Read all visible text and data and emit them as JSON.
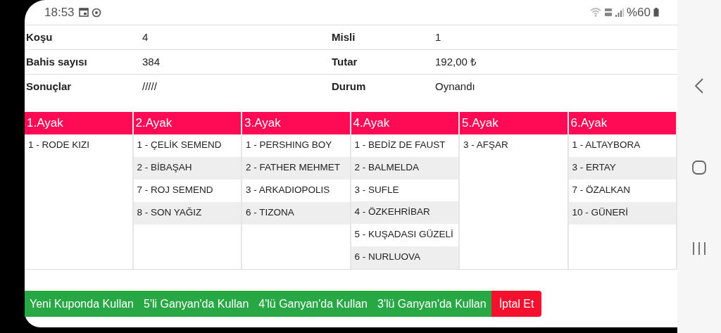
{
  "status_bar": {
    "time": "18:53",
    "battery": "%60"
  },
  "summary": [
    {
      "label": "Koşu",
      "value": "4",
      "label_2": "Misli",
      "value_2": "1"
    },
    {
      "label": "Bahis sayısı",
      "value": "384",
      "label_2": "Tutar",
      "value_2": "192,00 ₺"
    },
    {
      "label": "Sonuçlar",
      "value": "/////",
      "label_2": "Durum",
      "value_2": "Oynandı"
    }
  ],
  "legs": [
    {
      "title": "1.Ayak",
      "horses": [
        "1 - RODE KIZI"
      ]
    },
    {
      "title": "2.Ayak",
      "horses": [
        "1 - ÇELİK SEMEND",
        "2 - BİBAŞAH",
        "7 - ROJ SEMEND",
        "8 - SON YAĞIZ"
      ]
    },
    {
      "title": "3.Ayak",
      "horses": [
        "1 - PERSHING BOY",
        "2 - FATHER MEHMET",
        "3 - ARKADIOPOLIS",
        "6 - TIZONA"
      ]
    },
    {
      "title": "4.Ayak",
      "horses": [
        "1 - BEDİZ DE FAUST",
        "2 - BALMELDA",
        "3 - SUFLE",
        "4 - ÖZKEHRİBAR",
        "5 - KUŞADASI GÜZELİ",
        "6 - NURLUOVA"
      ]
    },
    {
      "title": "5.Ayak",
      "horses": [
        "3 - AFŞAR"
      ]
    },
    {
      "title": "6.Ayak",
      "horses": [
        "1 - ALTAYBORA",
        "3 - ERTAY",
        "7 - ÖZALKAN",
        "10 - GÜNERİ"
      ]
    }
  ],
  "buttons": [
    {
      "label": "Yeni Kuponda Kullan",
      "kind": "success"
    },
    {
      "label": "5'li Ganyan'da Kullan",
      "kind": "success"
    },
    {
      "label": "4'lü Ganyan'da Kullan",
      "kind": "success"
    },
    {
      "label": "3'lü Ganyan'da Kullan",
      "kind": "success"
    },
    {
      "label": "İptal Et",
      "kind": "danger"
    }
  ]
}
